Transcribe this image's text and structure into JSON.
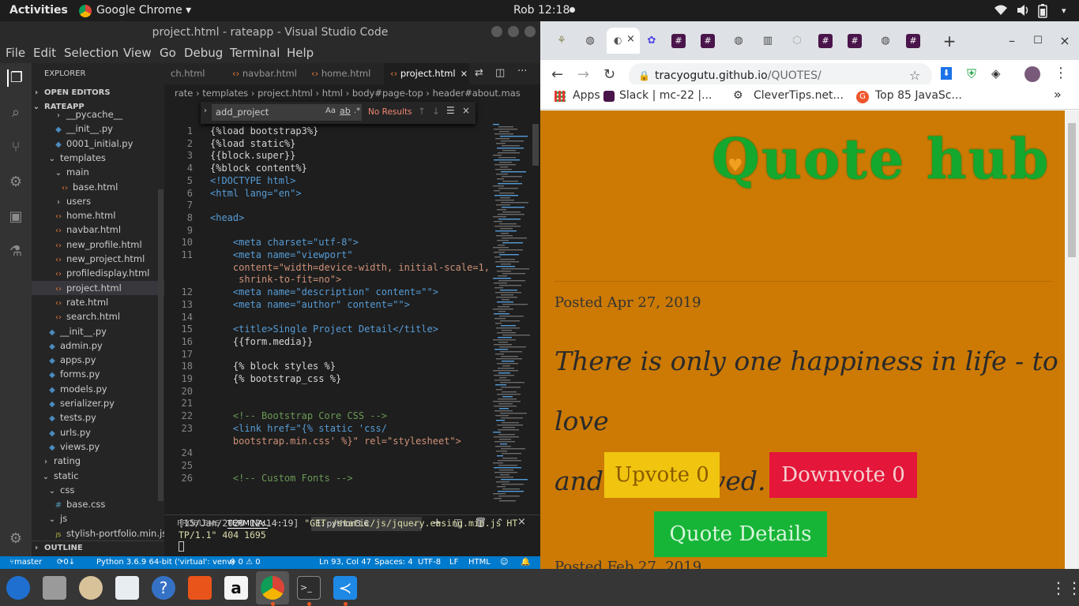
{
  "topbar": {
    "activities": "Activities",
    "app": "Google Chrome",
    "clock": "Rob 12:18"
  },
  "vscode": {
    "title": "project.html - rateapp - Visual Studio Code",
    "menu": [
      "File",
      "Edit",
      "Selection",
      "View",
      "Go",
      "Debug",
      "Terminal",
      "Help"
    ],
    "explorer": {
      "header": "EXPLORER",
      "open_editors": "OPEN EDITORS",
      "root": "RATEAPP",
      "outline": "OUTLINE",
      "items": [
        {
          "label": "__pycache__",
          "indent": 3,
          "icon": "folder"
        },
        {
          "label": "__init__.py",
          "indent": 3,
          "icon": "py"
        },
        {
          "label": "0001_initial.py",
          "indent": 3,
          "icon": "py"
        },
        {
          "label": "templates",
          "indent": 2,
          "icon": "chev-down"
        },
        {
          "label": "main",
          "indent": 3,
          "icon": "chev-down"
        },
        {
          "label": "base.html",
          "indent": 4,
          "icon": "html"
        },
        {
          "label": "users",
          "indent": 3,
          "icon": "chev-right"
        },
        {
          "label": "home.html",
          "indent": 3,
          "icon": "html"
        },
        {
          "label": "navbar.html",
          "indent": 3,
          "icon": "html"
        },
        {
          "label": "new_profile.html",
          "indent": 3,
          "icon": "html"
        },
        {
          "label": "new_project.html",
          "indent": 3,
          "icon": "html"
        },
        {
          "label": "profiledisplay.html",
          "indent": 3,
          "icon": "html"
        },
        {
          "label": "project.html",
          "indent": 3,
          "icon": "html",
          "selected": true
        },
        {
          "label": "rate.html",
          "indent": 3,
          "icon": "html"
        },
        {
          "label": "search.html",
          "indent": 3,
          "icon": "html"
        },
        {
          "label": "__init__.py",
          "indent": 2,
          "icon": "py"
        },
        {
          "label": "admin.py",
          "indent": 2,
          "icon": "py"
        },
        {
          "label": "apps.py",
          "indent": 2,
          "icon": "py"
        },
        {
          "label": "forms.py",
          "indent": 2,
          "icon": "py"
        },
        {
          "label": "models.py",
          "indent": 2,
          "icon": "py"
        },
        {
          "label": "serializer.py",
          "indent": 2,
          "icon": "py"
        },
        {
          "label": "tests.py",
          "indent": 2,
          "icon": "py"
        },
        {
          "label": "urls.py",
          "indent": 2,
          "icon": "py"
        },
        {
          "label": "views.py",
          "indent": 2,
          "icon": "py"
        },
        {
          "label": "rating",
          "indent": 1,
          "icon": "chev-right"
        },
        {
          "label": "static",
          "indent": 1,
          "icon": "chev-down"
        },
        {
          "label": "css",
          "indent": 2,
          "icon": "chev-down"
        },
        {
          "label": "base.css",
          "indent": 3,
          "icon": "css"
        },
        {
          "label": "js",
          "indent": 2,
          "icon": "chev-down"
        },
        {
          "label": "stylish-portfolio.min.js",
          "indent": 3,
          "icon": "js"
        }
      ]
    },
    "tabs": [
      {
        "label": "ch.html"
      },
      {
        "label": "navbar.html"
      },
      {
        "label": "home.html"
      },
      {
        "label": "project.html",
        "active": true
      }
    ],
    "breadcrumbs": "rate › templates › project.html › html › body#page-top › header#about.mas",
    "find": {
      "value": "add_project",
      "result": "No Results"
    },
    "code": [
      {
        "n": "1",
        "t": "{%load bootstrap3%}"
      },
      {
        "n": "2",
        "t": "{%load static%}"
      },
      {
        "n": "3",
        "t": "{{block.super}}"
      },
      {
        "n": "4",
        "t": "{%block content%}"
      },
      {
        "n": "5",
        "t": "<!DOCTYPE html>"
      },
      {
        "n": "6",
        "t": "<html lang=\"en\">"
      },
      {
        "n": "7",
        "t": ""
      },
      {
        "n": "8",
        "t": "<head>"
      },
      {
        "n": "9",
        "t": ""
      },
      {
        "n": "10",
        "t": "    <meta charset=\"utf-8\">"
      },
      {
        "n": "11",
        "t": "    <meta name=\"viewport\""
      },
      {
        "n": "",
        "t": "    content=\"width=device-width, initial-scale=1,"
      },
      {
        "n": "",
        "t": "     shrink-to-fit=no\">"
      },
      {
        "n": "12",
        "t": "    <meta name=\"description\" content=\"\">"
      },
      {
        "n": "13",
        "t": "    <meta name=\"author\" content=\"\">"
      },
      {
        "n": "14",
        "t": ""
      },
      {
        "n": "15",
        "t": "    <title>Single Project Detail</title>"
      },
      {
        "n": "16",
        "t": "    {{form.media}}"
      },
      {
        "n": "17",
        "t": ""
      },
      {
        "n": "18",
        "t": "    {% block styles %}"
      },
      {
        "n": "19",
        "t": "    {% bootstrap_css %}"
      },
      {
        "n": "20",
        "t": ""
      },
      {
        "n": "21",
        "t": ""
      },
      {
        "n": "22",
        "t": "    <!-- Bootstrap Core CSS -->"
      },
      {
        "n": "23",
        "t": "    <link href=\"{% static 'css/"
      },
      {
        "n": "",
        "t": "    bootstrap.min.css' %}\" rel=\"stylesheet\">"
      },
      {
        "n": "24",
        "t": ""
      },
      {
        "n": "25",
        "t": ""
      },
      {
        "n": "26",
        "t": "    <!-- Custom Fonts -->"
      }
    ],
    "panel": {
      "problems": "PROBLEMS",
      "terminal": "TERMINAL",
      "more": "···",
      "shell": "1: python3.6",
      "line1a": "[15/Jan/2020 12:14:19] ",
      "line1b": "\"GET /static/js/jquery.easing.min.js HT",
      "line2": "TP/1.1\" 404 1695"
    },
    "status": {
      "branch": "master",
      "sync": "0↓ 3↑",
      "python": "Python 3.6.9 64-bit ('virtual': venv)",
      "problems": "⊗ 0 ⚠ 0",
      "position": "Ln 93, Col 47",
      "spaces": "Spaces: 4",
      "encoding": "UTF-8",
      "eol": "LF",
      "language": "HTML"
    }
  },
  "chrome": {
    "url_host": "tracyogutu.github.io",
    "url_path": "/QUOTES/",
    "bookmarks": [
      "Apps",
      "Slack | mc-22 |...",
      "CleverTips.net...",
      "Top 85 JavaSc..."
    ],
    "page": {
      "heading": "Quote hub",
      "posted": "Posted Apr 27, 2019",
      "quote_line1": "There is only one happiness in life - to love",
      "quote_line2": "and to be loved.",
      "upvote": "Upvote 0",
      "downvote": "Downvote 0",
      "details": "Quote Details",
      "posted_next": "Posted Feb 27, 2019"
    }
  },
  "colors": {
    "page_bg": "#cc7a04",
    "heading": "#14a82e",
    "upvote_bg": "#f1c40f",
    "downvote_bg": "#e4163a",
    "details_bg": "#17b537"
  }
}
